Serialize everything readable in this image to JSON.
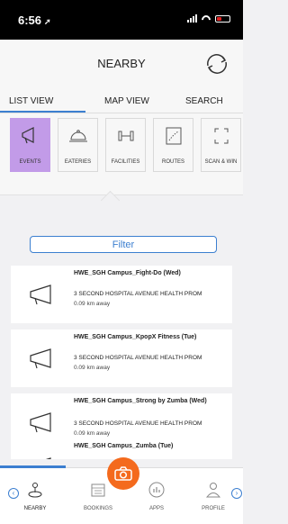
{
  "status_bar": {
    "time": "6:56",
    "location_glyph": "➚"
  },
  "header": {
    "title": "NEARBY"
  },
  "tabs": [
    {
      "label": "LIST VIEW"
    },
    {
      "label": "MAP VIEW"
    },
    {
      "label": "SEARCH"
    }
  ],
  "categories": [
    {
      "label": "EVENTS",
      "icon": "megaphone-icon"
    },
    {
      "label": "EATERIES",
      "icon": "cloche-icon"
    },
    {
      "label": "FACILITIES",
      "icon": "dumbbell-icon"
    },
    {
      "label": "ROUTES",
      "icon": "map-icon"
    },
    {
      "label": "SCAN & WIN",
      "icon": "scan-icon"
    }
  ],
  "filter": {
    "label": "Filter"
  },
  "events": [
    {
      "name": "HWE_SGH Campus_Fight-Do (Wed)",
      "address": "3 SECOND HOSPITAL AVENUE HEALTH PROM",
      "distance": "0.09 km away"
    },
    {
      "name": "HWE_SGH Campus_KpopX Fitness (Tue)",
      "address": "3 SECOND HOSPITAL AVENUE HEALTH PROM",
      "distance": "0.09 km away"
    },
    {
      "name": "HWE_SGH Campus_Strong by Zumba (Wed)",
      "address": "3 SECOND HOSPITAL AVENUE HEALTH PROM",
      "distance": "0.09 km away"
    },
    {
      "name": "HWE_SGH Campus_Zumba (Tue)",
      "address": "",
      "distance": ""
    }
  ],
  "bottom_nav": [
    {
      "label": "NEARBY",
      "icon": "nearby-icon"
    },
    {
      "label": "BOOKINGS",
      "icon": "calendar-icon"
    },
    {
      "label": "APPS",
      "icon": "apps-icon"
    },
    {
      "label": "PROFILE",
      "icon": "person-icon"
    }
  ],
  "colors": {
    "accent": "#3c7fd0",
    "active_category": "#c29be8",
    "camera": "#f46a1d"
  }
}
